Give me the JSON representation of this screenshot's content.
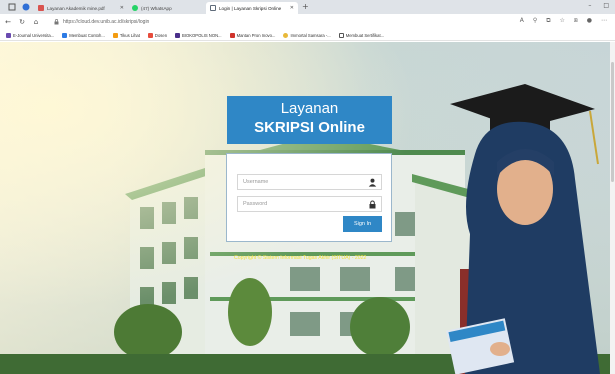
{
  "browser": {
    "tabs": [
      {
        "label": "Layanan Akademik mine.pdf",
        "fav_color": "#d9534f"
      },
      {
        "label": "(47) WhatsApp",
        "fav_color": "#25d366"
      },
      {
        "label": "Login | Layanan Skripsi Online",
        "fav_color": "#5f6b7a"
      }
    ],
    "new_tab": "+",
    "url": "https://cloud.dev.unib.ac.id/skripsi/login",
    "bookmarks": [
      {
        "label": "E-Journal Universita...",
        "color": "#6a4bb0"
      },
      {
        "label": "Membuat Contoh...",
        "color": "#2c7be5"
      },
      {
        "label": "Tikus Lihat",
        "color": "#f39c12"
      },
      {
        "label": "Dosen",
        "color": "#e74c3c"
      },
      {
        "label": "BIOKOPOLIS NON...",
        "color": "#4a2f8a"
      },
      {
        "label": "Mantan Pron Inovo...",
        "color": "#d0342c"
      },
      {
        "label": "Immortal Samsara -...",
        "color": "#e8b93a"
      },
      {
        "label": "Membuat Sertifikat...",
        "color": "#555555"
      }
    ]
  },
  "page": {
    "title_line1": "Layanan",
    "title_line2": "SKRIPSI Online",
    "username_placeholder": "Username",
    "password_placeholder": "Password",
    "signin_label": "Sign In",
    "copyright": "Copyright © Sistem Informasi Tugas Akhir (SITUA) - 2022"
  },
  "colors": {
    "brand": "#2f87c6",
    "copyright": "#f2e23d"
  }
}
